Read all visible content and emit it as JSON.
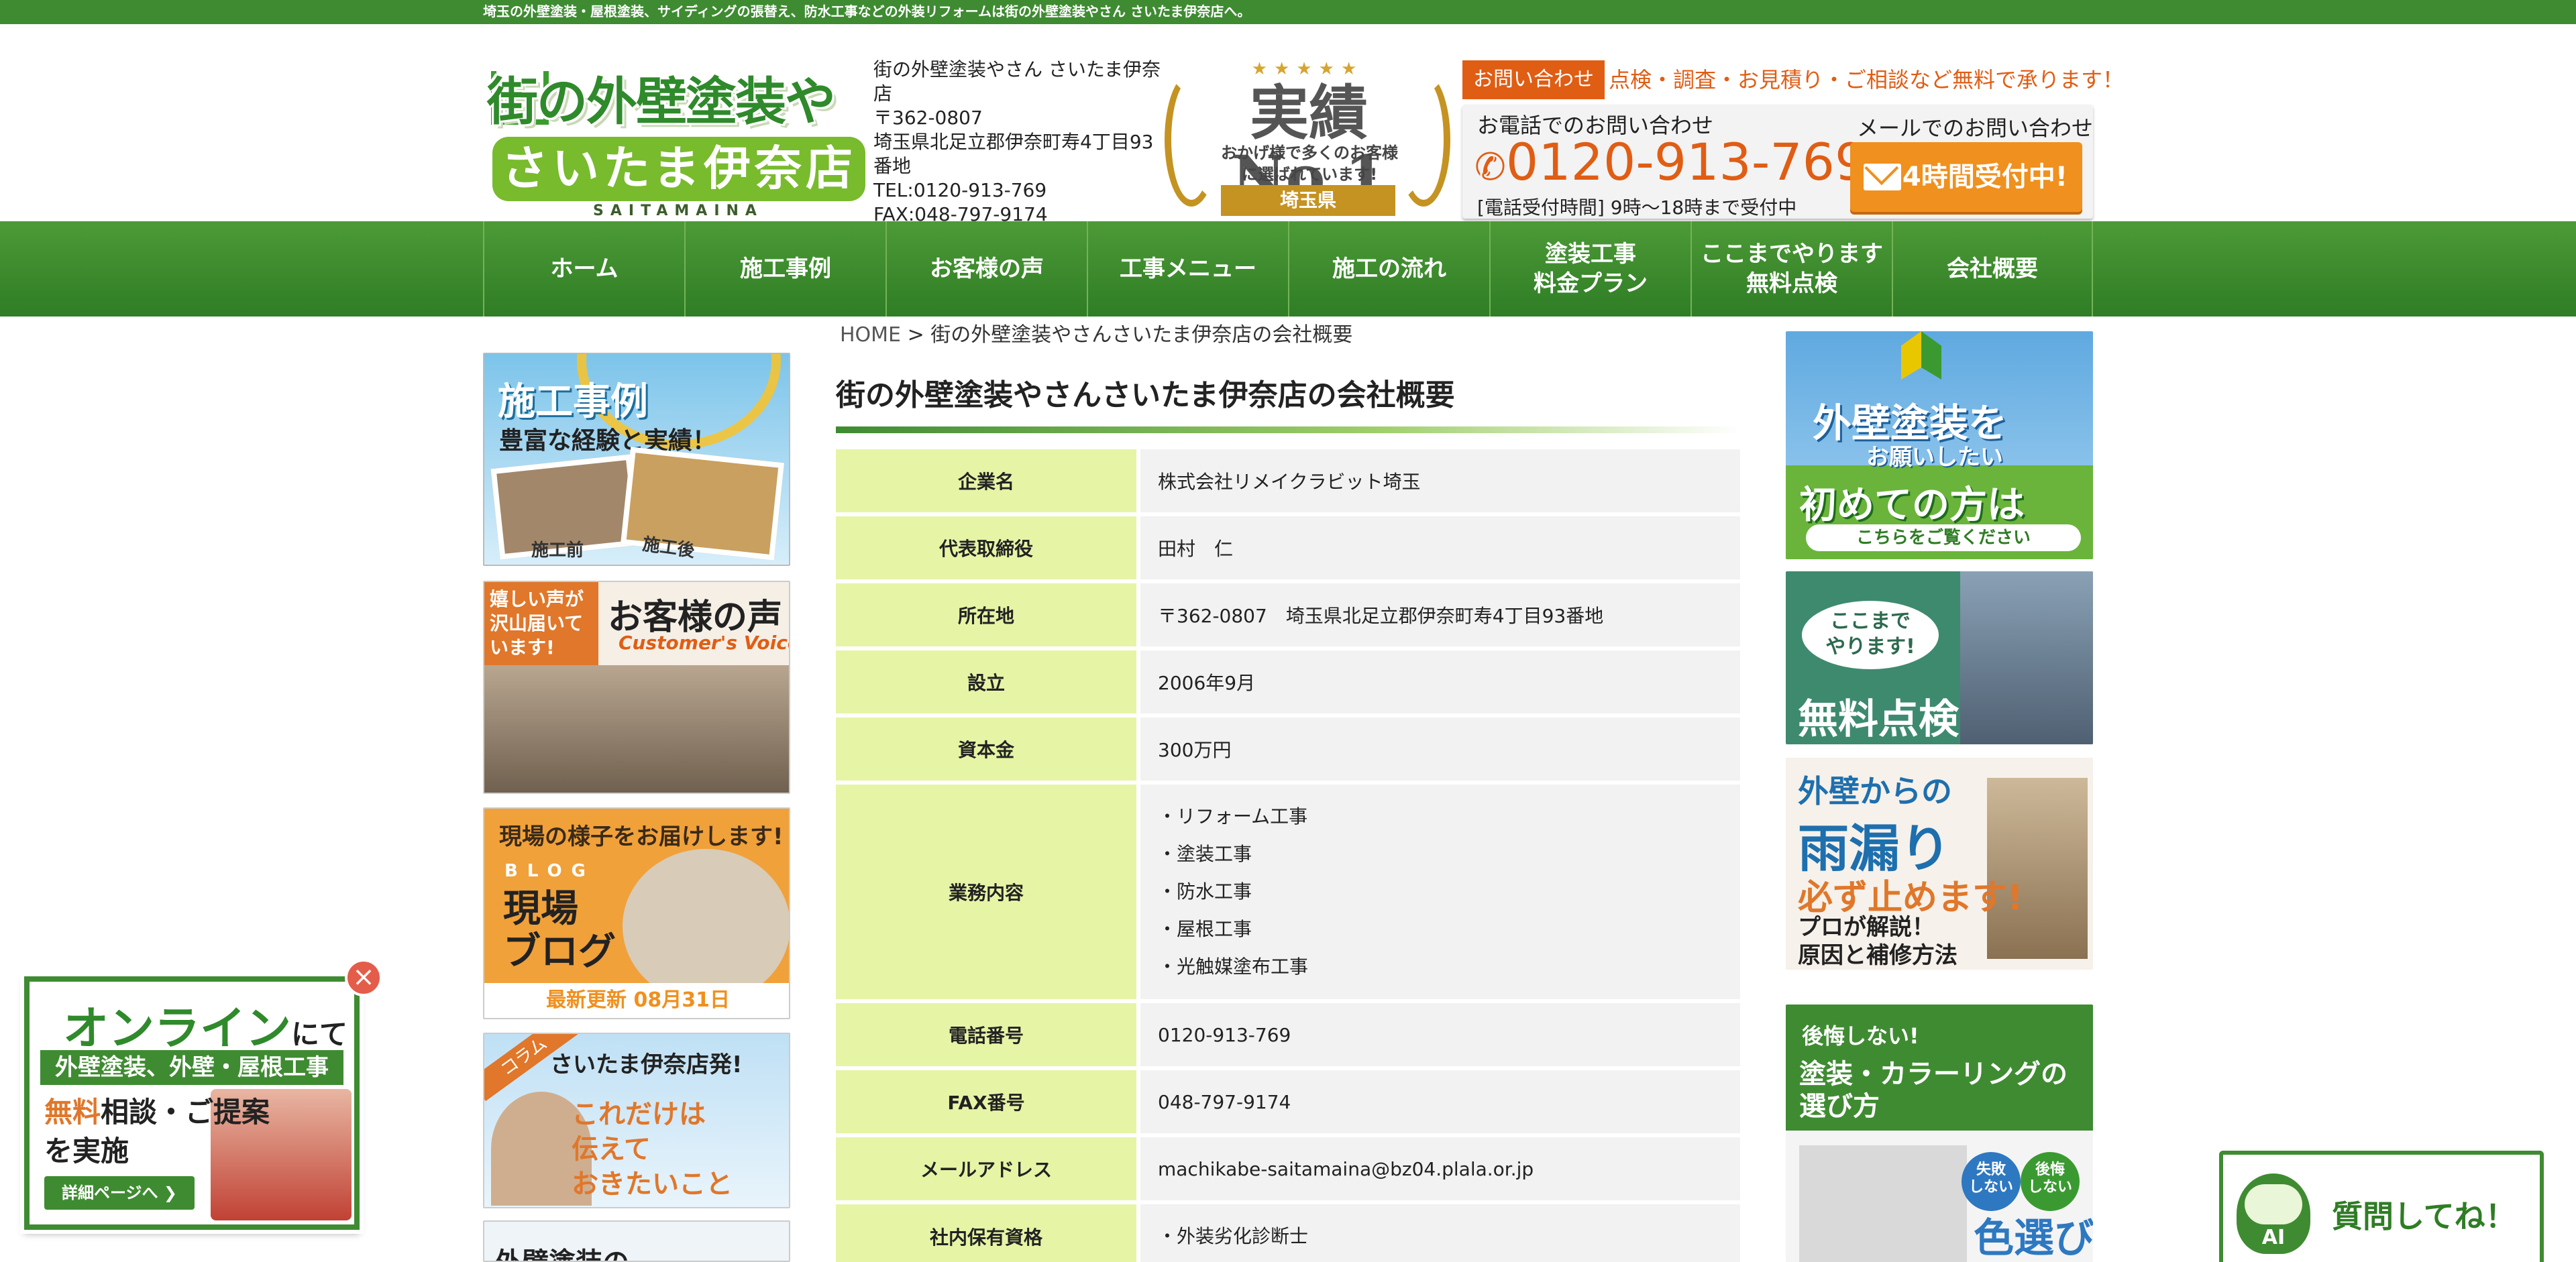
{
  "tagline": "埼玉の外壁塗装・屋根塗装、サイディングの張替え、防水工事などの外装リフォームは街の外壁塗装やさん さいたま伊奈店へ。",
  "logo": {
    "line1": "街の外壁塗装やさん",
    "line2": "さいたま伊奈店",
    "line3": "SAITAMAINA"
  },
  "address": {
    "name": "街の外壁塗装やさん さいたま伊奈店",
    "zip": "〒362-0807",
    "addr": "埼玉県北足立郡伊奈町寿4丁目93番地",
    "tel": "TEL:0120-913-769",
    "fax": "FAX:048-797-9174"
  },
  "badge": {
    "stars": "★★★★★",
    "main": "実績No.1",
    "sub": "おかげ様で多くのお客様に選ばれています!",
    "region": "埼玉県"
  },
  "contact": {
    "tag": "お問い合わせ",
    "lead": "点検・調査・お見積り・ご相談など無料で承ります！",
    "tel_label": "お電話でのお問い合わせ",
    "tel": "0120-913-769",
    "hours": "[電話受付時間] 9時～18時まで受付中",
    "mail_label": "メールでのお問い合わせ",
    "mail_button": "24時間受付中!"
  },
  "nav": [
    "ホーム",
    "施工事例",
    "お客様の声",
    "工事メニュー",
    "施工の流れ",
    "塗装工事\n料金プラン",
    "ここまでやります\n無料点検",
    "会社概要"
  ],
  "breadcrumb": {
    "home": "HOME",
    "sep": ">",
    "current": "街の外壁塗装やさんさいたま伊奈店の会社概要"
  },
  "left_banners": {
    "jirei": {
      "title": "施工事例",
      "sub": "豊富な経験と実績！",
      "before": "施工前",
      "after": "施工後"
    },
    "voice": {
      "tag": "嬉しい声が\n沢山届いて\nいます!",
      "title": "お客様の声",
      "en": "Customer's Voice!"
    },
    "blog": {
      "lead": "現場の様子をお届けします!",
      "en": "BLOG",
      "title": "現場\nブログ",
      "updated": "最新更新 08月31日"
    },
    "column": {
      "tag": "コラム",
      "title": "さいたま伊奈店発!",
      "body": "これだけは\n伝えて\nおきたいこと"
    },
    "next": {
      "title": "外壁塗装の"
    }
  },
  "right_banners": {
    "first": {
      "t1": "外壁塗装を",
      "t2": "お願いしたい",
      "t3": "初めての方は",
      "pill": "こちらをご覧ください"
    },
    "free": {
      "bubble": "ここまで\nやります!",
      "title": "無料点検"
    },
    "leak": {
      "t1": "外壁からの",
      "t2": "雨漏り",
      "t3": "必ず止めます!",
      "t4": "プロが解説！\n原因と補修方法"
    },
    "color": {
      "t1": "後悔しない!",
      "t2": "塗装・カラーリングの\n選び方",
      "c1": "失敗\nしない",
      "c2": "後悔\nしない",
      "t3": "色選び"
    }
  },
  "main": {
    "title": "街の外壁塗装やさんさいたま伊奈店の会社概要",
    "rows": [
      {
        "label": "企業名",
        "value": "株式会社リメイクラビット埼玉"
      },
      {
        "label": "代表取締役",
        "value": "田村　仁"
      },
      {
        "label": "所在地",
        "value": "〒362-0807　埼玉県北足立郡伊奈町寿4丁目93番地"
      },
      {
        "label": "設立",
        "value": "2006年9月"
      },
      {
        "label": "資本金",
        "value": "300万円"
      },
      {
        "label": "業務内容",
        "items": [
          "・リフォーム工事",
          "・塗装工事",
          "・防水工事",
          "・屋根工事",
          "・光触媒塗布工事"
        ]
      },
      {
        "label": "電話番号",
        "value": "0120-913-769"
      },
      {
        "label": "FAX番号",
        "value": "048-797-9174"
      },
      {
        "label": "メールアドレス",
        "value": "machikabe-saitamaina@bz04.plala.or.jp"
      },
      {
        "label": "社内保有資格",
        "items": [
          "・外装劣化診断士"
        ]
      }
    ]
  },
  "online": {
    "title": "オンライン",
    "title_suffix": "にて",
    "strip": "外壁塗装、外壁・屋根工事",
    "body_hl": "無料",
    "body_rest": "相談・ご提案",
    "body_line2": "を実施",
    "detail": "詳細ページへ ❯",
    "close": "×"
  },
  "ai_widget": {
    "label": "AI",
    "text": "質問してね！"
  },
  "colors": {
    "brand_green": "#3f8b32",
    "accent_orange": "#e05d14",
    "table_label_bg": "#e6f4a6",
    "table_value_bg": "#f2f2f2"
  }
}
